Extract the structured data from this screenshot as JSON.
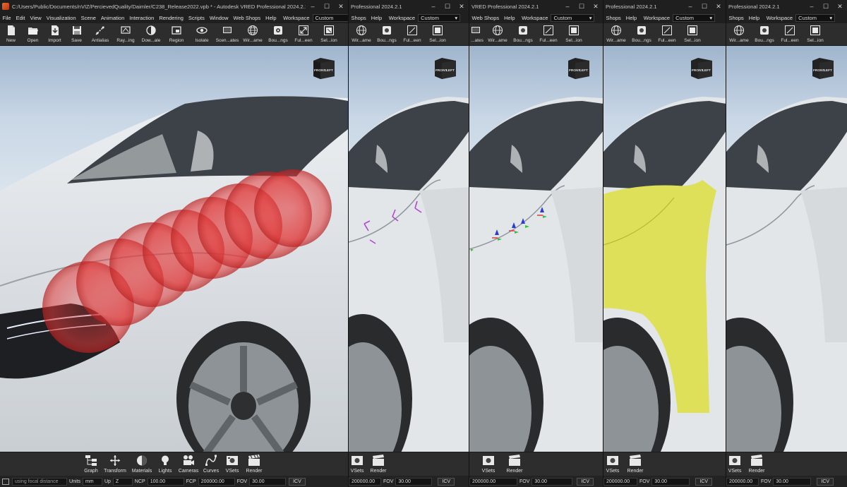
{
  "colors": {
    "chrome_bg": "#2d2d2d",
    "titlebar_bg": "#1f1f1f",
    "highlight_yellow": "#dfe05a",
    "gizmo_magenta": "#b245d6",
    "sphere_red": "#e23a3a"
  },
  "panel1": {
    "title": "C:/Users/Public/Documents/nVIZ/PercievedQuality/Daimler/C238_Release2022.vpb * - Autodesk VRED Professional 2024.2.1",
    "menu": [
      "File",
      "Edit",
      "View",
      "Visualization",
      "Scene",
      "Animation",
      "Interaction",
      "Rendering",
      "Scripts",
      "Window",
      "Web Shops",
      "Help"
    ],
    "workspace_label": "Workspace",
    "workspace_value": "Custom",
    "toolbar": [
      {
        "icon": "new-file-icon",
        "label": "New"
      },
      {
        "icon": "open-folder-icon",
        "label": "Open"
      },
      {
        "icon": "import-icon",
        "label": "Import"
      },
      {
        "icon": "save-icon",
        "label": "Save"
      },
      {
        "icon": "antialias-icon",
        "label": "Antialias"
      },
      {
        "icon": "raytracing-icon",
        "label": "Ray...ing"
      },
      {
        "icon": "downscale-icon",
        "label": "Dow...ale"
      },
      {
        "icon": "region-icon",
        "label": "Region"
      },
      {
        "icon": "isolate-icon",
        "label": "Isolate"
      },
      {
        "icon": "scene-states-icon",
        "label": "Scen...ates"
      },
      {
        "icon": "wireframe-icon",
        "label": "Wir...ame"
      },
      {
        "icon": "bounding-box-icon",
        "label": "Bou...ngs"
      },
      {
        "icon": "fullscreen-icon",
        "label": "Ful...een"
      },
      {
        "icon": "selection-icon",
        "label": "Sel...ion"
      }
    ],
    "bottom_tools": [
      {
        "icon": "graph-icon",
        "label": "Graph"
      },
      {
        "icon": "transform-icon",
        "label": "Transform"
      },
      {
        "icon": "materials-icon",
        "label": "Materials"
      },
      {
        "icon": "lights-icon",
        "label": "Lights"
      },
      {
        "icon": "cameras-icon",
        "label": "Cameras"
      },
      {
        "icon": "curves-icon",
        "label": "Curves"
      },
      {
        "icon": "vsets-icon",
        "label": "VSets"
      },
      {
        "icon": "render-icon",
        "label": "Render"
      }
    ],
    "status": {
      "console": "using focal distance",
      "units_label": "Units",
      "units_value": "mm",
      "up_label": "Up",
      "up_value": "Z",
      "ncp_label": "NCP",
      "ncp_value": "100.00",
      "fcp_label": "FCP",
      "fcp_value": "200000.00",
      "fov_label": "FOV",
      "fov_value": "30.00",
      "icv_label": "ICV"
    },
    "navcube_front": "FRONT",
    "navcube_left": "LEFT"
  },
  "panel2": {
    "title": "Professional 2024.2.1",
    "menu": [
      "Shops",
      "Help"
    ],
    "workspace_label": "Workspace",
    "workspace_value": "Custom",
    "toolbar": [
      {
        "icon": "wireframe-icon",
        "label": "Wir...ame"
      },
      {
        "icon": "bounding-box-icon",
        "label": "Bou...ngs"
      },
      {
        "icon": "fullscreen-icon",
        "label": "Ful...een"
      },
      {
        "icon": "selection-icon",
        "label": "Sel...ion"
      }
    ],
    "bottom_tools": [
      {
        "icon": "vsets-icon",
        "label": "VSets"
      },
      {
        "icon": "render-icon",
        "label": "Render"
      }
    ],
    "status": {
      "fcp_value": "200000.00",
      "fov_label": "FOV",
      "fov_value": "30.00",
      "icv_label": "ICV"
    },
    "navcube_front": "FRONT",
    "navcube_left": "LEFT"
  },
  "panel3": {
    "title": "VRED Professional 2024.2.1",
    "menu": [
      "Web Shops",
      "Help"
    ],
    "workspace_label": "Workspace",
    "workspace_value": "Custom",
    "toolbar": [
      {
        "icon": "scene-states-icon",
        "label": "...ates"
      },
      {
        "icon": "wireframe-icon",
        "label": "Wir...ame"
      },
      {
        "icon": "bounding-box-icon",
        "label": "Bou...ngs"
      },
      {
        "icon": "fullscreen-icon",
        "label": "Ful...een"
      },
      {
        "icon": "selection-icon",
        "label": "Sel...ion"
      }
    ],
    "bottom_tools": [
      {
        "icon": "vsets-icon",
        "label": "VSets"
      },
      {
        "icon": "render-icon",
        "label": "Render"
      }
    ],
    "status": {
      "fcp_value": "200000.00",
      "fov_label": "FOV",
      "fov_value": "30.00",
      "icv_label": "ICV"
    },
    "navcube_front": "FRONT",
    "navcube_left": "LEFT"
  },
  "panel4": {
    "title": "Professional 2024.2.1",
    "menu": [
      "Shops",
      "Help"
    ],
    "workspace_label": "Workspace",
    "workspace_value": "Custom",
    "toolbar": [
      {
        "icon": "wireframe-icon",
        "label": "Wir...ame"
      },
      {
        "icon": "bounding-box-icon",
        "label": "Bou...ngs"
      },
      {
        "icon": "fullscreen-icon",
        "label": "Ful...een"
      },
      {
        "icon": "selection-icon",
        "label": "Sel...ion"
      }
    ],
    "bottom_tools": [
      {
        "icon": "vsets-icon",
        "label": "VSets"
      },
      {
        "icon": "render-icon",
        "label": "Render"
      }
    ],
    "status": {
      "fcp_value": "200000.00",
      "fov_label": "FOV",
      "fov_value": "30.00",
      "icv_label": "ICV"
    },
    "navcube_front": "FRONT",
    "navcube_left": "LEFT"
  },
  "panel5": {
    "title": "Professional 2024.2.1",
    "menu": [
      "Shops",
      "Help"
    ],
    "workspace_label": "Workspace",
    "workspace_value": "Custom",
    "toolbar": [
      {
        "icon": "wireframe-icon",
        "label": "Wir...ame"
      },
      {
        "icon": "bounding-box-icon",
        "label": "Bou...ngs"
      },
      {
        "icon": "fullscreen-icon",
        "label": "Ful...een"
      },
      {
        "icon": "selection-icon",
        "label": "Sel...ion"
      }
    ],
    "bottom_tools": [
      {
        "icon": "vsets-icon",
        "label": "VSets"
      },
      {
        "icon": "render-icon",
        "label": "Render"
      }
    ],
    "status": {
      "fcp_value": "200000.00",
      "fov_label": "FOV",
      "fov_value": "30.00",
      "icv_label": "ICV"
    },
    "navcube_front": "FRONT",
    "navcube_left": "LEFT"
  }
}
